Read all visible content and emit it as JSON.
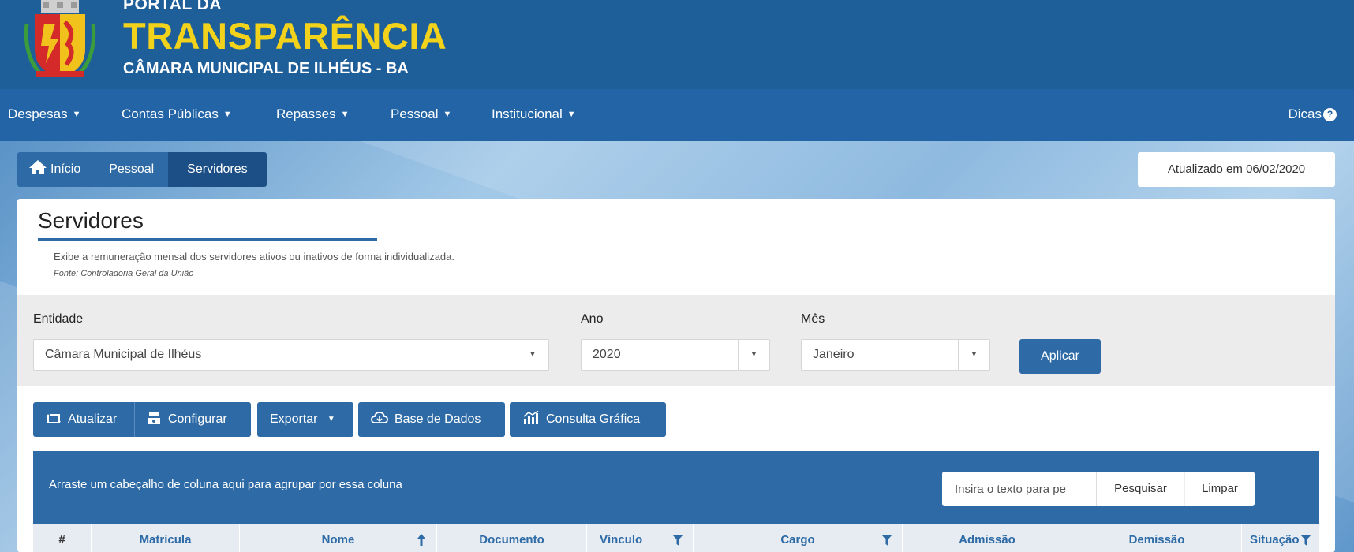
{
  "header": {
    "portal_da": "PORTAL DA",
    "transparencia": "TRANSPARÊNCIA",
    "subtitle": "CÂMARA MUNICIPAL DE ILHÉUS - BA",
    "logo_icon": "coat-of-arms-icon"
  },
  "nav": {
    "items": [
      {
        "label": "Despesas"
      },
      {
        "label": "Contas Públicas"
      },
      {
        "label": "Repasses"
      },
      {
        "label": "Pessoal"
      },
      {
        "label": "Institucional"
      }
    ],
    "dicas": "Dicas"
  },
  "breadcrumb": {
    "home": "Início",
    "pessoal": "Pessoal",
    "current": "Servidores"
  },
  "updated": "Atualizado em 06/02/2020",
  "page": {
    "title": "Servidores",
    "description": "Exibe a remuneração mensal dos servidores ativos ou inativos de forma individualizada.",
    "source": "Fonte: Controladoria Geral da União"
  },
  "filters": {
    "entidade_label": "Entidade",
    "entidade_value": "Câmara Municipal de Ilhéus",
    "ano_label": "Ano",
    "ano_value": "2020",
    "mes_label": "Mês",
    "mes_value": "Janeiro",
    "apply": "Aplicar"
  },
  "toolbar": {
    "atualizar": "Atualizar",
    "configurar": "Configurar",
    "exportar": "Exportar",
    "base_dados": "Base de Dados",
    "consulta_grafica": "Consulta Gráfica"
  },
  "grid": {
    "group_hint": "Arraste um cabeçalho de coluna aqui para agrupar por essa coluna",
    "search_placeholder": "Insira o texto para pe",
    "search_button": "Pesquisar",
    "clear_button": "Limpar",
    "columns": {
      "index": "#",
      "matricula": "Matrícula",
      "nome": "Nome",
      "documento": "Documento",
      "vinculo": "Vínculo",
      "cargo": "Cargo",
      "admissao": "Admissão",
      "demissao": "Demissão",
      "situacao": "Situação"
    }
  },
  "colors": {
    "header_bg": "#1f5f99",
    "nav_bg": "#2264a5",
    "accent": "#2e6ba6",
    "title_yellow": "#f2d21a"
  }
}
